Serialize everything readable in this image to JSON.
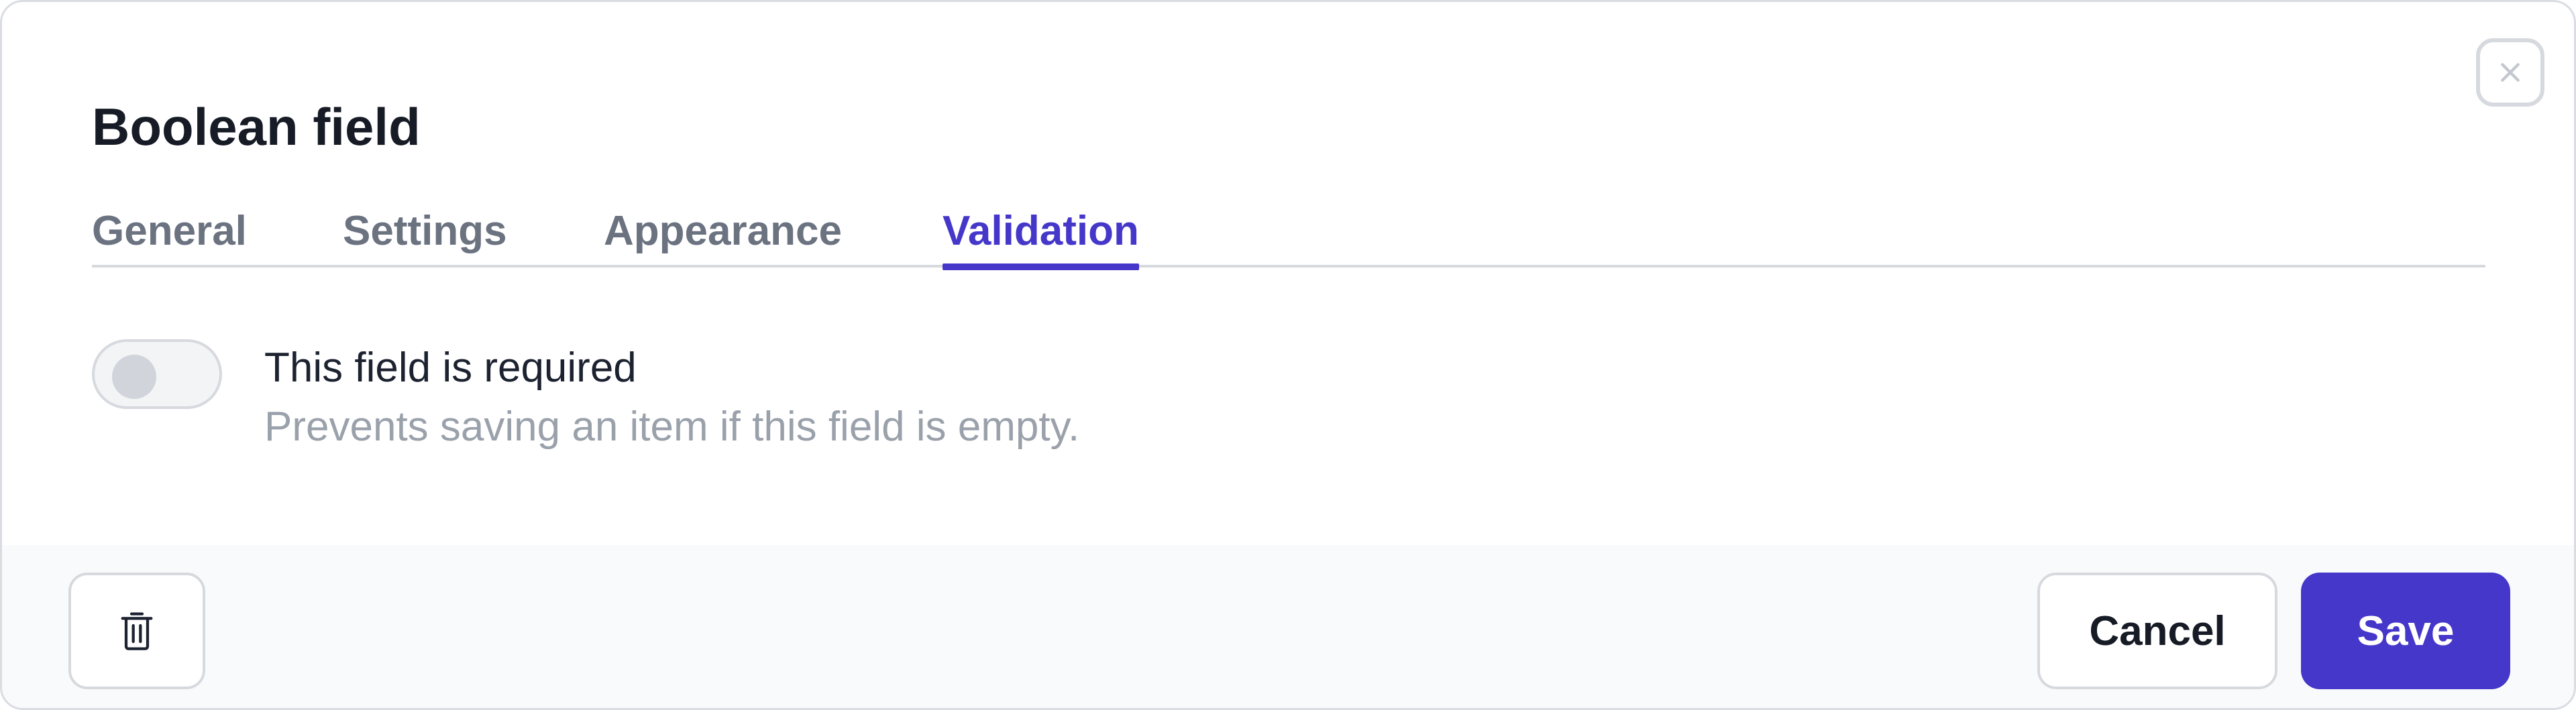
{
  "dialog": {
    "title": "Boolean field",
    "close_icon": "close-icon"
  },
  "tabs": [
    {
      "label": "General",
      "active": false
    },
    {
      "label": "Settings",
      "active": false
    },
    {
      "label": "Appearance",
      "active": false
    },
    {
      "label": "Validation",
      "active": true
    }
  ],
  "validation": {
    "required_toggle": {
      "on": false,
      "label": "This field is required",
      "description": "Prevents saving an item if this field is empty."
    }
  },
  "footer": {
    "delete_icon": "trash-icon",
    "cancel_label": "Cancel",
    "save_label": "Save"
  },
  "colors": {
    "accent": "#4537c9",
    "border": "#d6d9de",
    "muted_text": "#9aa1ab",
    "tab_text": "#6b7280",
    "footer_bg": "#f9fafb"
  }
}
